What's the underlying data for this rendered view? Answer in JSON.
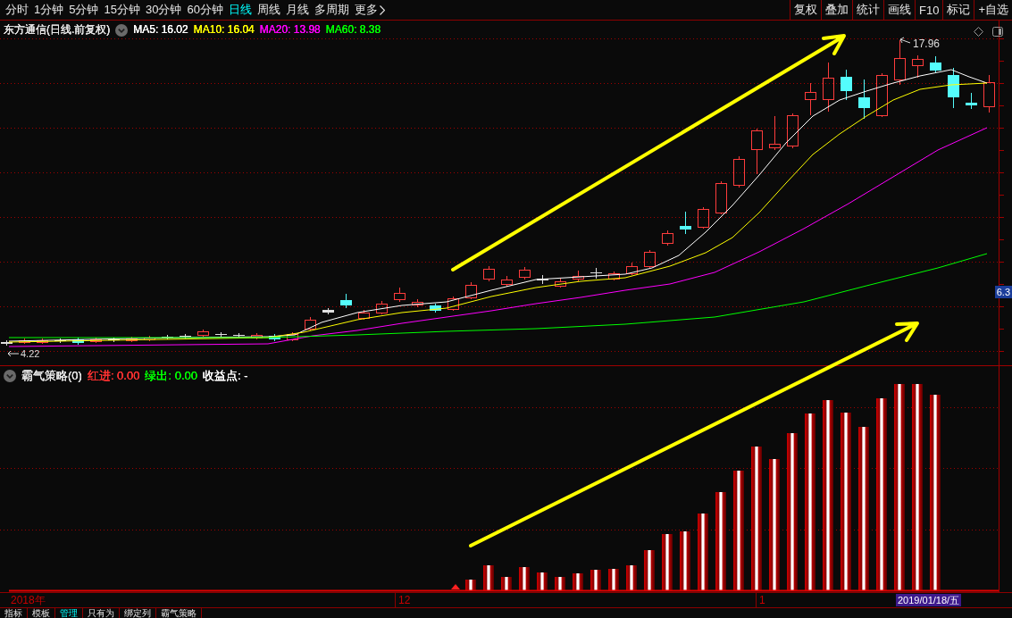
{
  "toolbar": {
    "periods": [
      {
        "label": "分时",
        "selected": false
      },
      {
        "label": "1分钟",
        "selected": false
      },
      {
        "label": "5分钟",
        "selected": false
      },
      {
        "label": "15分钟",
        "selected": false
      },
      {
        "label": "30分钟",
        "selected": false
      },
      {
        "label": "60分钟",
        "selected": false
      },
      {
        "label": "日线",
        "selected": true
      },
      {
        "label": "周线",
        "selected": false
      },
      {
        "label": "月线",
        "selected": false
      },
      {
        "label": "多周期",
        "selected": false
      }
    ],
    "more": "更多",
    "buttons": [
      "复权",
      "叠加",
      "统计",
      "画线",
      "F10",
      "标记",
      "+自选"
    ]
  },
  "main_chart": {
    "title": "东方通信(日线.前复权)",
    "moving_averages": [
      {
        "label": "MA5: 16.02",
        "color": "#ffffff"
      },
      {
        "label": "MA10: 16.04",
        "color": "#ffff00"
      },
      {
        "label": "MA20: 13.98",
        "color": "#ff00ff"
      },
      {
        "label": "MA60: 8.38",
        "color": "#00ff00"
      }
    ],
    "high_label": "17.96",
    "low_label": "4.22",
    "price_tag": "6.3"
  },
  "indicator": {
    "title": "霸气策略(0)",
    "readouts": [
      {
        "label": "红进: 0.00",
        "color": "#ff3232"
      },
      {
        "label": "绿出: 0.00",
        "color": "#00ff00"
      },
      {
        "label": "收益点: -",
        "color": "#ffffff"
      }
    ]
  },
  "time_axis": {
    "labels": [
      "2018年",
      "12",
      "1"
    ],
    "cursor_date": "2019/01/18/五"
  },
  "bottom_tabs": [
    {
      "label": "指标",
      "selected": false
    },
    {
      "label": "模板",
      "selected": false
    },
    {
      "label": "管理",
      "selected": true
    },
    {
      "label": "只有为",
      "selected": false
    },
    {
      "label": "绑定列",
      "selected": false
    },
    {
      "label": "霸气策略",
      "selected": false
    }
  ]
}
